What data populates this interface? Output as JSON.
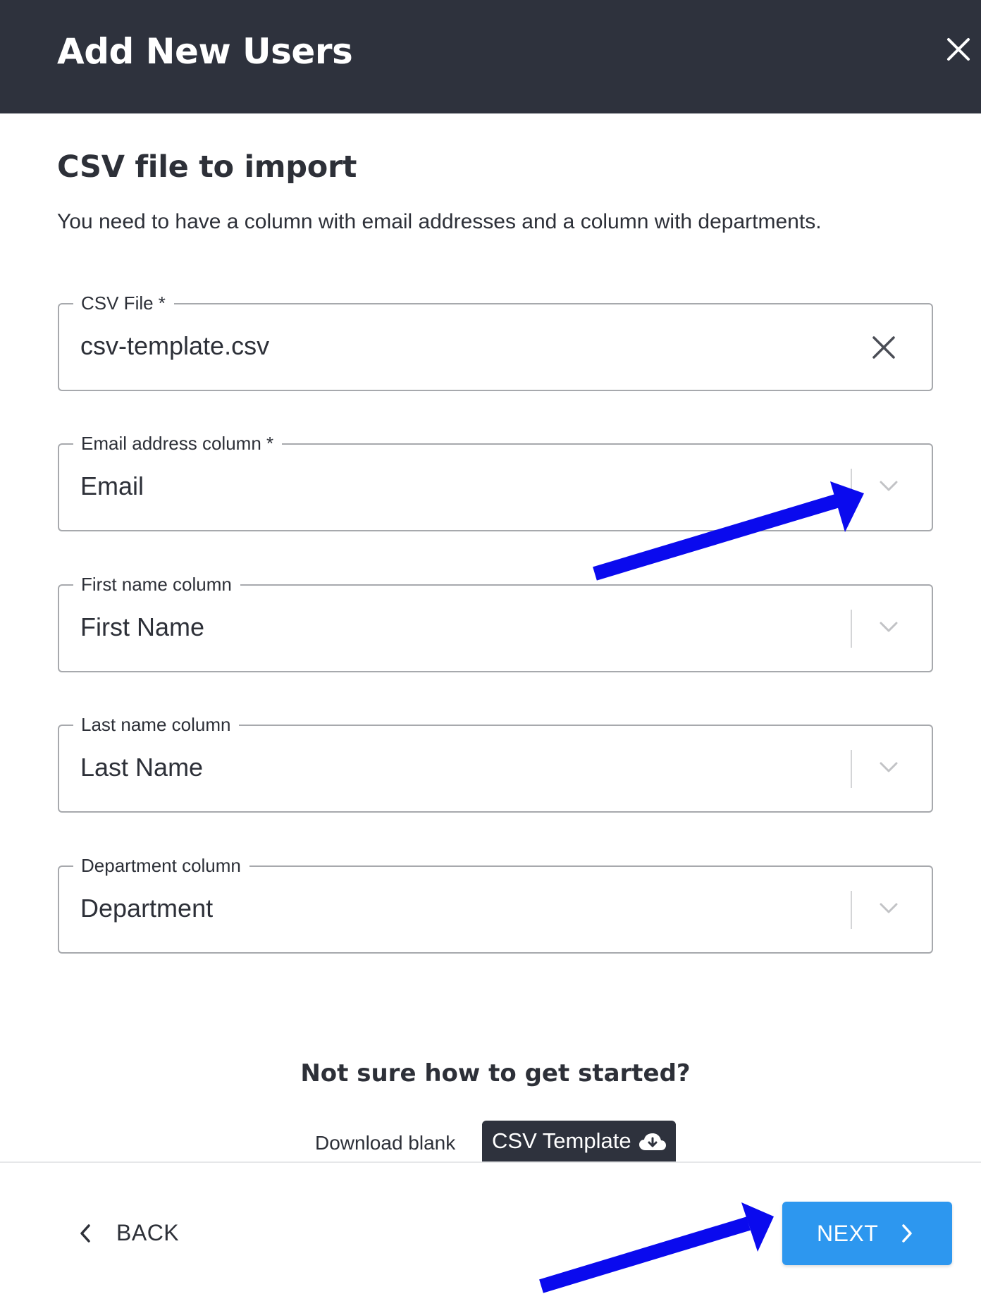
{
  "dialog": {
    "title": "Add New Users"
  },
  "section": {
    "title": "CSV file to import",
    "description": "You need to have a column with email addresses and a column with departments."
  },
  "fields": {
    "csv_file": {
      "label": "CSV File *",
      "value": "csv-template.csv"
    },
    "email_column": {
      "label": "Email address column *",
      "value": "Email"
    },
    "first_name_column": {
      "label": "First name column",
      "value": "First Name"
    },
    "last_name_column": {
      "label": "Last name column",
      "value": "Last Name"
    },
    "department_column": {
      "label": "Department column",
      "value": "Department"
    }
  },
  "help": {
    "title": "Not sure how to get started?",
    "download_label": "Download blank",
    "template_button_label": "CSV Template"
  },
  "footer": {
    "back_label": "BACK",
    "next_label": "NEXT"
  },
  "icons": {
    "close": "close-icon",
    "clear": "clear-icon",
    "dropdown": "chevron-down-icon",
    "download": "cloud-download-icon",
    "back": "chevron-left-icon",
    "next": "chevron-right-icon"
  },
  "colors": {
    "header_bg": "#2e323d",
    "primary_button": "#2d97ef",
    "annotation_arrow": "#0a0aee"
  }
}
